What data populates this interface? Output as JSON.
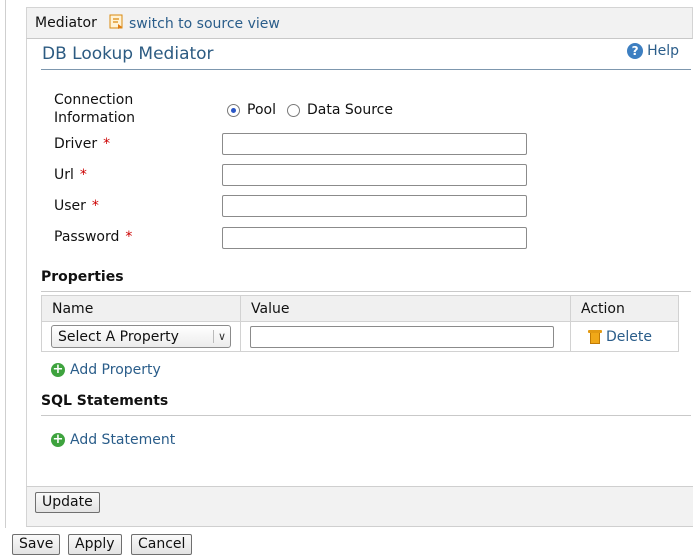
{
  "header": {
    "title": "Mediator",
    "switch_link": "switch to source view",
    "switch_icon": "source-view-icon"
  },
  "panel": {
    "title": "DB Lookup Mediator",
    "help_label": "Help",
    "help_icon": "help-icon"
  },
  "connection": {
    "label": "Connection Information",
    "options": [
      {
        "label": "Pool",
        "selected": true
      },
      {
        "label": "Data Source",
        "selected": false
      }
    ]
  },
  "fields": [
    {
      "label": "Driver",
      "required": "*",
      "value": ""
    },
    {
      "label": "Url",
      "required": "*",
      "value": ""
    },
    {
      "label": "User",
      "required": "*",
      "value": ""
    },
    {
      "label": "Password",
      "required": "*",
      "value": ""
    }
  ],
  "properties": {
    "title": "Properties",
    "columns": [
      "Name",
      "Value",
      "Action"
    ],
    "rows": [
      {
        "name_select": "Select A Property",
        "value": "",
        "action": "Delete"
      }
    ],
    "add_label": "Add Property"
  },
  "sql": {
    "title": "SQL Statements",
    "add_label": "Add Statement"
  },
  "buttons": {
    "update": "Update",
    "save": "Save",
    "apply": "Apply",
    "cancel": "Cancel"
  },
  "colors": {
    "link": "#2a5d8a",
    "title": "#2c5b82",
    "required": "#cc0000",
    "add_icon": "#3ea33e"
  }
}
